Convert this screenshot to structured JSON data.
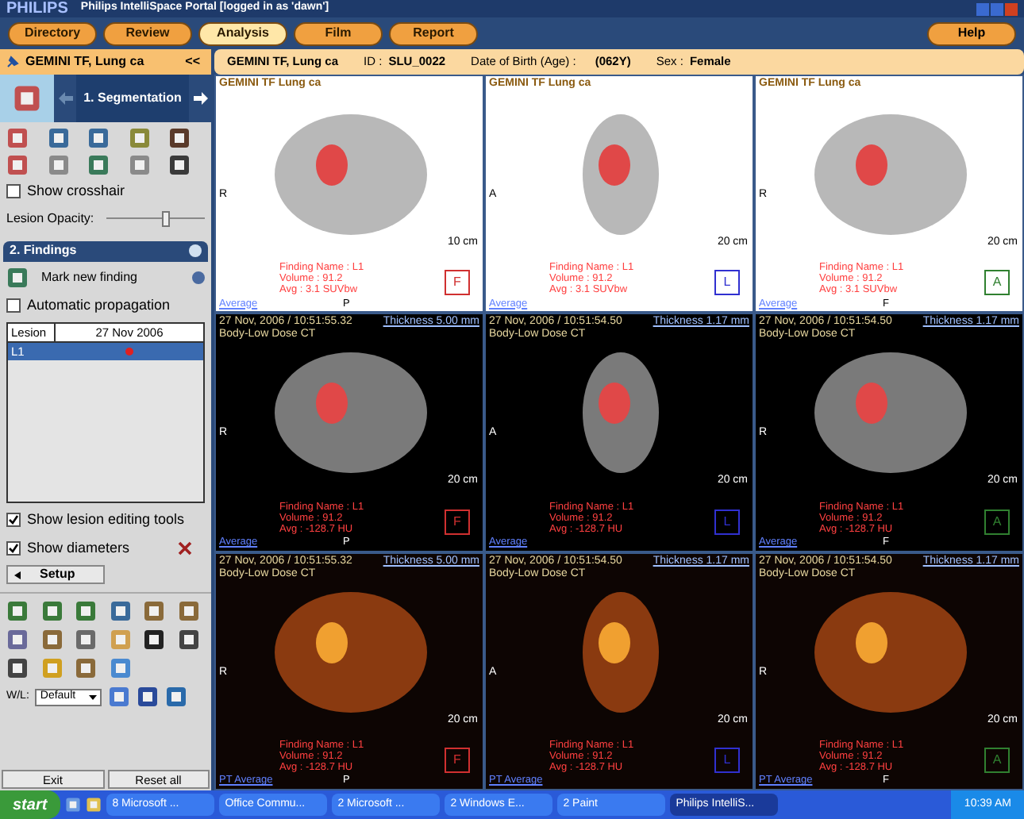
{
  "window": {
    "logo": "PHILIPS",
    "title": "Philips IntelliSpace Portal [logged in as 'dawn']"
  },
  "nav": [
    {
      "label": "Directory",
      "selected": false
    },
    {
      "label": "Review",
      "selected": false
    },
    {
      "label": "Analysis",
      "selected": true
    },
    {
      "label": "Film",
      "selected": false
    },
    {
      "label": "Report",
      "selected": false
    }
  ],
  "help": "Help",
  "patient_bar": {
    "short_name": "GEMINI TF, Lung ca",
    "collapse": "<<",
    "name": "GEMINI TF, Lung ca",
    "id_label": "ID :",
    "id": "SLU_0022",
    "dob_label": "Date of Birth (Age) :",
    "dob": "(062Y)",
    "sex_label": "Sex :",
    "sex": "Female"
  },
  "segmentation": {
    "step": "1. Segmentation",
    "show_crosshair": {
      "label": "Show crosshair",
      "checked": false
    },
    "opacity": {
      "label": "Lesion Opacity:",
      "level": 0.62
    }
  },
  "findings": {
    "title": "2. Findings",
    "mark": "Mark new finding",
    "propagation": {
      "label": "Automatic propagation",
      "checked": false
    },
    "columns": [
      "Lesion",
      "27 Nov 2006"
    ],
    "rows": [
      {
        "name": "L1",
        "selected": true,
        "color": "#e02020"
      }
    ],
    "options": [
      {
        "label": "Show lesion editing tools",
        "checked": true
      },
      {
        "label": "Show diameters",
        "checked": true
      }
    ],
    "setup": "Setup"
  },
  "wl": {
    "label": "W/L:",
    "value": "Default"
  },
  "bottom_buttons": [
    "Exit",
    "Reset all"
  ],
  "viewports": [
    {
      "kind": "pet",
      "top": [
        "GEMINI TF Lung ca"
      ],
      "side": "R",
      "scale": "10 cm",
      "finding": [
        "Finding Name : L1",
        "Volume : 91.2",
        "Avg : 3.1  SUVbw"
      ],
      "marker": "F",
      "color": "#d03030",
      "bottom": "Average",
      "bottom_center": "P"
    },
    {
      "kind": "pet",
      "top": [
        "GEMINI TF Lung ca"
      ],
      "side": "A",
      "scale": "20 cm",
      "finding": [
        "Finding Name : L1",
        "Volume : 91.2",
        "Avg : 3.1  SUVbw"
      ],
      "marker": "L",
      "color": "#3030d0",
      "bottom": "Average"
    },
    {
      "kind": "pet",
      "top": [
        "GEMINI TF Lung ca"
      ],
      "side": "R",
      "scale": "20 cm",
      "finding": [
        "Finding Name : L1",
        "Volume : 91.2",
        "Avg : 3.1  SUVbw"
      ],
      "marker": "A",
      "color": "#308030",
      "bottom": "Average",
      "bottom_center": "F"
    },
    {
      "kind": "ct",
      "top": [
        "27 Nov, 2006 / 10:51:55.32",
        "Body-Low Dose CT"
      ],
      "thickness": "Thickness 5.00 mm",
      "side": "R",
      "scale": "20 cm",
      "finding": [
        "Finding Name : L1",
        "Volume : 91.2",
        "Avg : -128.7  HU"
      ],
      "marker": "F",
      "color": "#d03030",
      "bottom": "Average",
      "bottom_center": "P"
    },
    {
      "kind": "ct",
      "top": [
        "27 Nov, 2006 / 10:51:54.50",
        "Body-Low Dose CT"
      ],
      "thickness": "Thickness 1.17 mm",
      "side": "A",
      "scale": "20 cm",
      "finding": [
        "Finding Name : L1",
        "Volume : 91.2",
        "Avg : -128.7  HU"
      ],
      "marker": "L",
      "color": "#3030d0",
      "bottom": "Average"
    },
    {
      "kind": "ct",
      "top": [
        "27 Nov, 2006 / 10:51:54.50",
        "Body-Low Dose CT"
      ],
      "thickness": "Thickness 1.17 mm",
      "side": "R",
      "scale": "20 cm",
      "finding": [
        "Finding Name : L1",
        "Volume : 91.2",
        "Avg : -128.7  HU"
      ],
      "marker": "A",
      "color": "#308030",
      "bottom": "Average",
      "bottom_center": "F"
    },
    {
      "kind": "fused",
      "top": [
        "27 Nov, 2006 / 10:51:55.32",
        "Body-Low Dose CT"
      ],
      "thickness": "Thickness 5.00 mm",
      "side": "R",
      "scale": "20 cm",
      "finding": [
        "Finding Name : L1",
        "Volume : 91.2",
        "Avg : -128.7  HU"
      ],
      "marker": "F",
      "color": "#d03030",
      "bottom": "PT Average",
      "bottom_center": "P"
    },
    {
      "kind": "fused",
      "top": [
        "27 Nov, 2006 / 10:51:54.50",
        "Body-Low Dose CT"
      ],
      "thickness": "Thickness 1.17 mm",
      "side": "A",
      "scale": "20 cm",
      "finding": [
        "Finding Name : L1",
        "Volume : 91.2",
        "Avg : -128.7  HU"
      ],
      "marker": "L",
      "color": "#3030d0",
      "bottom": "PT Average"
    },
    {
      "kind": "fused",
      "top": [
        "27 Nov, 2006 / 10:51:54.50",
        "Body-Low Dose CT"
      ],
      "thickness": "Thickness 1.17 mm",
      "side": "R",
      "scale": "20 cm",
      "finding": [
        "Finding Name : L1",
        "Volume : 91.2",
        "Avg : -128.7  HU"
      ],
      "marker": "A",
      "color": "#308030",
      "bottom": "PT Average",
      "bottom_center": "F"
    }
  ],
  "taskbar": {
    "start": "start",
    "items": [
      {
        "label": "8 Microsoft ...",
        "selected": false
      },
      {
        "label": "Office Commu...",
        "selected": false
      },
      {
        "label": "2 Microsoft ...",
        "selected": false
      },
      {
        "label": "2 Windows E...",
        "selected": false
      },
      {
        "label": "2 Paint",
        "selected": false
      },
      {
        "label": "Philips IntelliS...",
        "selected": true
      }
    ],
    "clock": "10:39 AM"
  }
}
